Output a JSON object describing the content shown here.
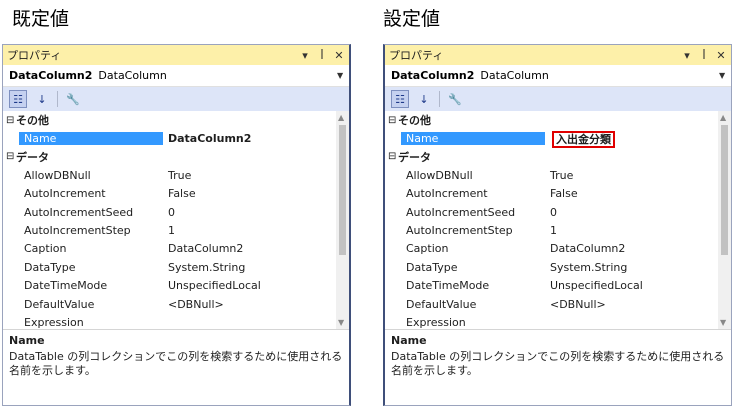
{
  "headings": {
    "default": "既定値",
    "setting": "設定値"
  },
  "panel": {
    "title": "プロパティ",
    "dropdown_glyph": "▾",
    "pin_glyph": "ꟾ",
    "close_glyph": "✕",
    "object_name": "DataColumn2",
    "object_type": "DataColumn"
  },
  "categories": {
    "other": "その他",
    "data": "データ"
  },
  "props": {
    "name": "Name",
    "allowdbnull": "AllowDBNull",
    "autoincrement": "AutoIncrement",
    "autoincrementseed": "AutoIncrementSeed",
    "autoincrementstep": "AutoIncrementStep",
    "caption": "Caption",
    "datatype": "DataType",
    "datetimemode": "DateTimeMode",
    "defaultvalue": "DefaultValue",
    "expression": "Expression"
  },
  "left_values": {
    "name": "DataColumn2",
    "allowdbnull": "True",
    "autoincrement": "False",
    "autoincrementseed": "0",
    "autoincrementstep": "1",
    "caption": "DataColumn2",
    "datatype": "System.String",
    "datetimemode": "UnspecifiedLocal",
    "defaultvalue": "<DBNull>",
    "expression": ""
  },
  "right_values": {
    "name": "入出金分類",
    "allowdbnull": "True",
    "autoincrement": "False",
    "autoincrementseed": "0",
    "autoincrementstep": "1",
    "caption": "DataColumn2",
    "datatype": "System.String",
    "datetimemode": "UnspecifiedLocal",
    "defaultvalue": "<DBNull>",
    "expression": ""
  },
  "description": {
    "title": "Name",
    "text": "DataTable の列コレクションでこの列を検索するために使用される名前を示します。"
  },
  "icons": [
    "categorized-icon",
    "alphabetical-icon",
    "property-pages-icon"
  ]
}
